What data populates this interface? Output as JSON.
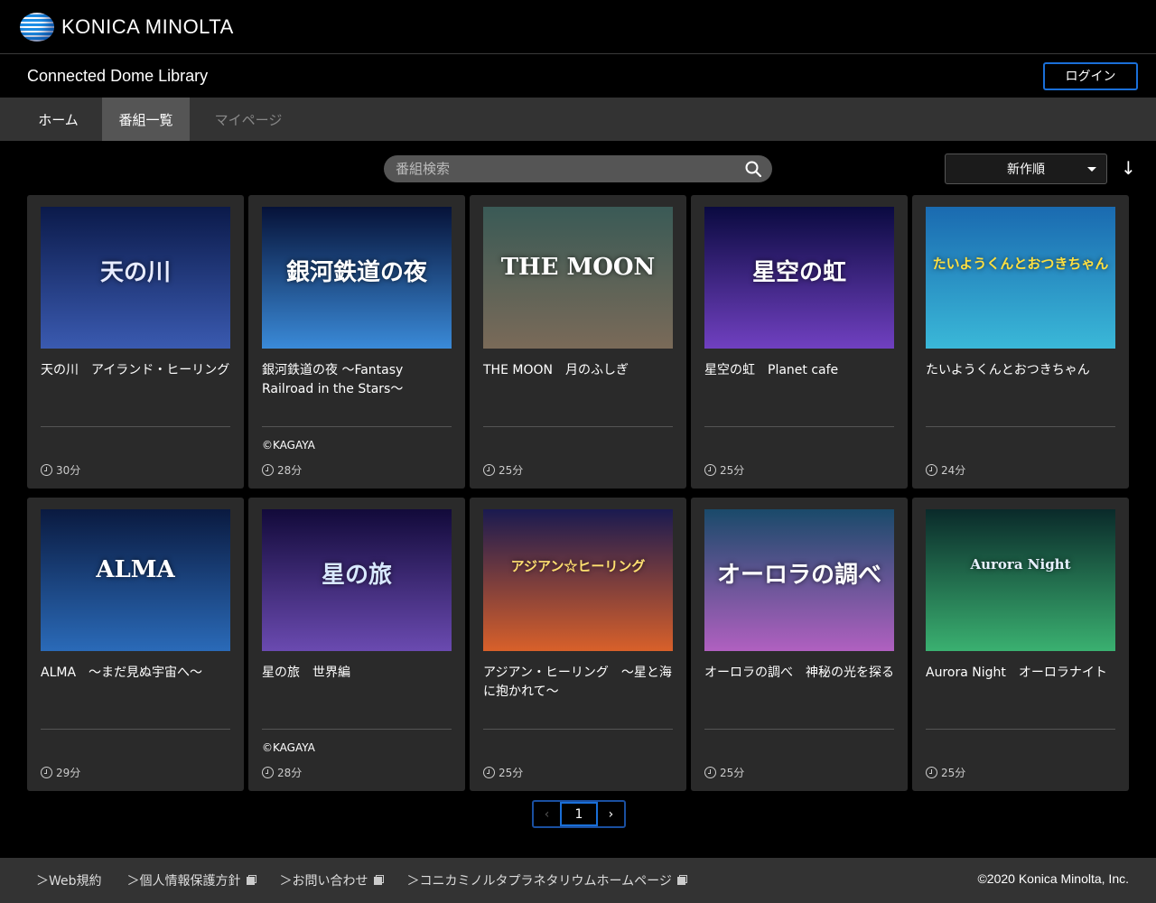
{
  "brand": {
    "logo_text": "KONICA MINOLTA"
  },
  "header": {
    "site_title": "Connected Dome Library",
    "login_label": "ログイン"
  },
  "nav": {
    "items": [
      {
        "label": "ホーム"
      },
      {
        "label": "番組一覧"
      },
      {
        "label": "マイページ"
      }
    ],
    "active_index": 1
  },
  "toolbar": {
    "search_placeholder": "番組検索",
    "sort_selected": "新作順",
    "sort_direction": "↓"
  },
  "programs": [
    {
      "title": "天の川　アイランド・ヒーリング",
      "credit": "",
      "duration": "30分",
      "thumb_text": "天の川",
      "thumb_bg": [
        "#0b1a4a",
        "#3a5ab0"
      ],
      "thumb_text_color": "#e8ecff"
    },
    {
      "title": "銀河鉄道の夜 ～Fantasy Railroad in the Stars～",
      "credit": "©KAGAYA",
      "duration": "28分",
      "thumb_text": "銀河鉄道の夜",
      "thumb_bg": [
        "#061238",
        "#3a8ad8"
      ],
      "thumb_text_color": "#ffffff"
    },
    {
      "title": "THE MOON　月のふしぎ",
      "credit": "",
      "duration": "25分",
      "thumb_text": "THE MOON",
      "thumb_bg": [
        "#3a5a56",
        "#7a6a58"
      ],
      "thumb_text_color": "#ffffff"
    },
    {
      "title": "星空の虹　Planet cafe",
      "credit": "",
      "duration": "25分",
      "thumb_text": "星空の虹",
      "thumb_bg": [
        "#0a0a40",
        "#7040c0"
      ],
      "thumb_text_color": "#ffffff"
    },
    {
      "title": "たいようくんとおつきちゃん",
      "credit": "",
      "duration": "24分",
      "thumb_text": "たいようくんとおつきちゃん",
      "thumb_bg": [
        "#1a6ab0",
        "#3ab8d8"
      ],
      "thumb_text_color": "#ffe040"
    },
    {
      "title": "ALMA　～まだ見ぬ宇宙へ～",
      "credit": "",
      "duration": "29分",
      "thumb_text": "ALMA",
      "thumb_bg": [
        "#0a1a40",
        "#2a6ab8"
      ],
      "thumb_text_color": "#ffffff"
    },
    {
      "title": "星の旅　世界編",
      "credit": "©KAGAYA",
      "duration": "28分",
      "thumb_text": "星の旅",
      "thumb_bg": [
        "#120a3a",
        "#6a4ab0"
      ],
      "thumb_text_color": "#d8e8ff"
    },
    {
      "title": "アジアン・ヒーリング　～星と海に抱かれて～",
      "credit": "",
      "duration": "25分",
      "thumb_text": "アジアン☆ヒーリング",
      "thumb_bg": [
        "#1a1a50",
        "#d8602a"
      ],
      "thumb_text_color": "#ffe070"
    },
    {
      "title": "オーロラの調べ　神秘の光を探る",
      "credit": "",
      "duration": "25分",
      "thumb_text": "オーロラの調べ",
      "thumb_bg": [
        "#1a4a6a",
        "#b060c0"
      ],
      "thumb_text_color": "#ffffff"
    },
    {
      "title": "Aurora Night　オーロラナイト",
      "credit": "",
      "duration": "25分",
      "thumb_text": "Aurora Night",
      "thumb_bg": [
        "#0a2a2a",
        "#3ab070"
      ],
      "thumb_text_color": "#e8f0ff"
    }
  ],
  "pagination": {
    "prev": "‹",
    "current": "1",
    "next": "›"
  },
  "footer": {
    "links": [
      {
        "label": "＞Web規約",
        "external": false
      },
      {
        "label": "＞個人情報保護方針",
        "external": true
      },
      {
        "label": "＞お問い合わせ",
        "external": true
      },
      {
        "label": "＞コニカミノルタプラネタリウムホームページ",
        "external": true
      }
    ],
    "copyright": "©2020 Konica Minolta, Inc."
  },
  "colors": {
    "accent": "#1a6fd8",
    "card_bg": "#2a2a2a",
    "nav_bg": "#333333",
    "nav_active": "#555555"
  }
}
